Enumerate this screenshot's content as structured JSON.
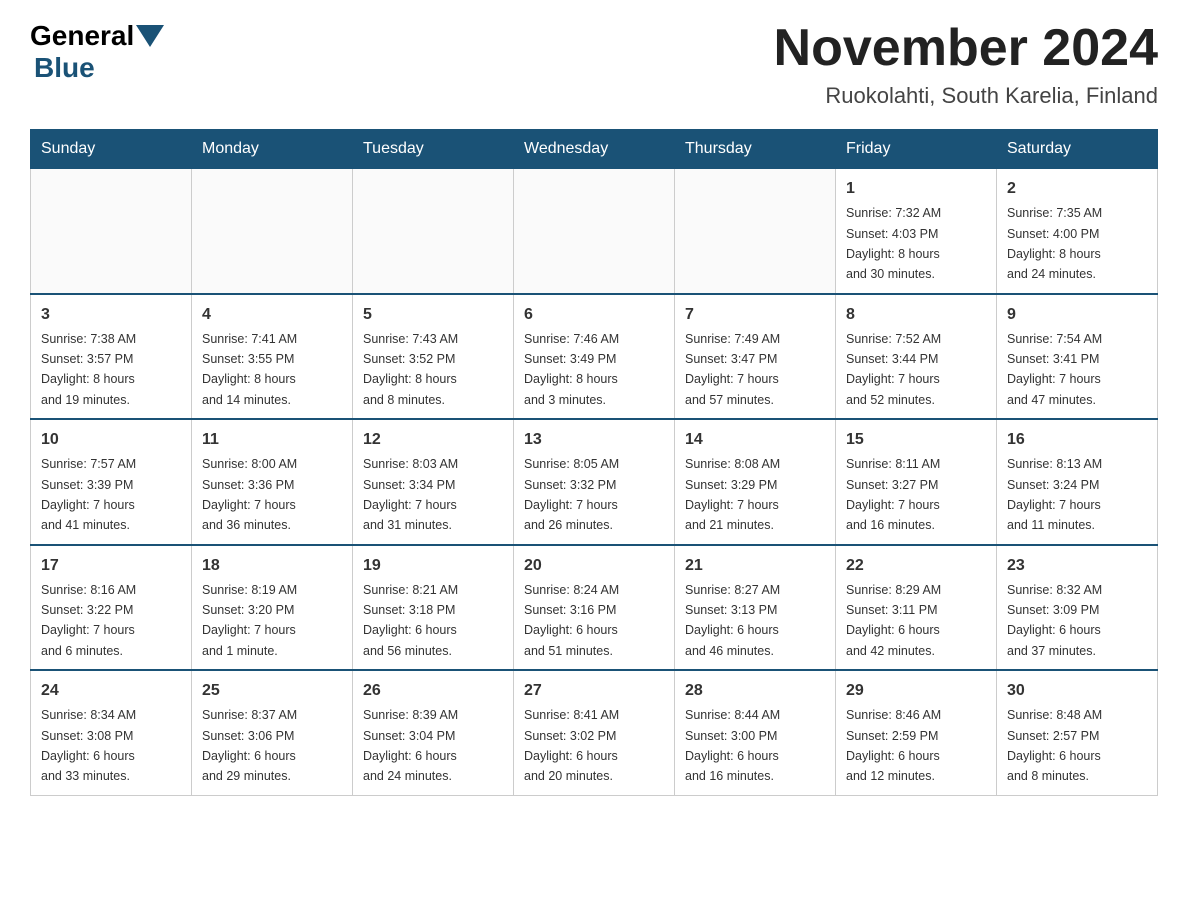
{
  "header": {
    "logo_general": "General",
    "logo_blue": "Blue",
    "month_title": "November 2024",
    "subtitle": "Ruokolahti, South Karelia, Finland"
  },
  "weekdays": [
    "Sunday",
    "Monday",
    "Tuesday",
    "Wednesday",
    "Thursday",
    "Friday",
    "Saturday"
  ],
  "weeks": [
    [
      {
        "day": "",
        "info": ""
      },
      {
        "day": "",
        "info": ""
      },
      {
        "day": "",
        "info": ""
      },
      {
        "day": "",
        "info": ""
      },
      {
        "day": "",
        "info": ""
      },
      {
        "day": "1",
        "info": "Sunrise: 7:32 AM\nSunset: 4:03 PM\nDaylight: 8 hours\nand 30 minutes."
      },
      {
        "day": "2",
        "info": "Sunrise: 7:35 AM\nSunset: 4:00 PM\nDaylight: 8 hours\nand 24 minutes."
      }
    ],
    [
      {
        "day": "3",
        "info": "Sunrise: 7:38 AM\nSunset: 3:57 PM\nDaylight: 8 hours\nand 19 minutes."
      },
      {
        "day": "4",
        "info": "Sunrise: 7:41 AM\nSunset: 3:55 PM\nDaylight: 8 hours\nand 14 minutes."
      },
      {
        "day": "5",
        "info": "Sunrise: 7:43 AM\nSunset: 3:52 PM\nDaylight: 8 hours\nand 8 minutes."
      },
      {
        "day": "6",
        "info": "Sunrise: 7:46 AM\nSunset: 3:49 PM\nDaylight: 8 hours\nand 3 minutes."
      },
      {
        "day": "7",
        "info": "Sunrise: 7:49 AM\nSunset: 3:47 PM\nDaylight: 7 hours\nand 57 minutes."
      },
      {
        "day": "8",
        "info": "Sunrise: 7:52 AM\nSunset: 3:44 PM\nDaylight: 7 hours\nand 52 minutes."
      },
      {
        "day": "9",
        "info": "Sunrise: 7:54 AM\nSunset: 3:41 PM\nDaylight: 7 hours\nand 47 minutes."
      }
    ],
    [
      {
        "day": "10",
        "info": "Sunrise: 7:57 AM\nSunset: 3:39 PM\nDaylight: 7 hours\nand 41 minutes."
      },
      {
        "day": "11",
        "info": "Sunrise: 8:00 AM\nSunset: 3:36 PM\nDaylight: 7 hours\nand 36 minutes."
      },
      {
        "day": "12",
        "info": "Sunrise: 8:03 AM\nSunset: 3:34 PM\nDaylight: 7 hours\nand 31 minutes."
      },
      {
        "day": "13",
        "info": "Sunrise: 8:05 AM\nSunset: 3:32 PM\nDaylight: 7 hours\nand 26 minutes."
      },
      {
        "day": "14",
        "info": "Sunrise: 8:08 AM\nSunset: 3:29 PM\nDaylight: 7 hours\nand 21 minutes."
      },
      {
        "day": "15",
        "info": "Sunrise: 8:11 AM\nSunset: 3:27 PM\nDaylight: 7 hours\nand 16 minutes."
      },
      {
        "day": "16",
        "info": "Sunrise: 8:13 AM\nSunset: 3:24 PM\nDaylight: 7 hours\nand 11 minutes."
      }
    ],
    [
      {
        "day": "17",
        "info": "Sunrise: 8:16 AM\nSunset: 3:22 PM\nDaylight: 7 hours\nand 6 minutes."
      },
      {
        "day": "18",
        "info": "Sunrise: 8:19 AM\nSunset: 3:20 PM\nDaylight: 7 hours\nand 1 minute."
      },
      {
        "day": "19",
        "info": "Sunrise: 8:21 AM\nSunset: 3:18 PM\nDaylight: 6 hours\nand 56 minutes."
      },
      {
        "day": "20",
        "info": "Sunrise: 8:24 AM\nSunset: 3:16 PM\nDaylight: 6 hours\nand 51 minutes."
      },
      {
        "day": "21",
        "info": "Sunrise: 8:27 AM\nSunset: 3:13 PM\nDaylight: 6 hours\nand 46 minutes."
      },
      {
        "day": "22",
        "info": "Sunrise: 8:29 AM\nSunset: 3:11 PM\nDaylight: 6 hours\nand 42 minutes."
      },
      {
        "day": "23",
        "info": "Sunrise: 8:32 AM\nSunset: 3:09 PM\nDaylight: 6 hours\nand 37 minutes."
      }
    ],
    [
      {
        "day": "24",
        "info": "Sunrise: 8:34 AM\nSunset: 3:08 PM\nDaylight: 6 hours\nand 33 minutes."
      },
      {
        "day": "25",
        "info": "Sunrise: 8:37 AM\nSunset: 3:06 PM\nDaylight: 6 hours\nand 29 minutes."
      },
      {
        "day": "26",
        "info": "Sunrise: 8:39 AM\nSunset: 3:04 PM\nDaylight: 6 hours\nand 24 minutes."
      },
      {
        "day": "27",
        "info": "Sunrise: 8:41 AM\nSunset: 3:02 PM\nDaylight: 6 hours\nand 20 minutes."
      },
      {
        "day": "28",
        "info": "Sunrise: 8:44 AM\nSunset: 3:00 PM\nDaylight: 6 hours\nand 16 minutes."
      },
      {
        "day": "29",
        "info": "Sunrise: 8:46 AM\nSunset: 2:59 PM\nDaylight: 6 hours\nand 12 minutes."
      },
      {
        "day": "30",
        "info": "Sunrise: 8:48 AM\nSunset: 2:57 PM\nDaylight: 6 hours\nand 8 minutes."
      }
    ]
  ]
}
